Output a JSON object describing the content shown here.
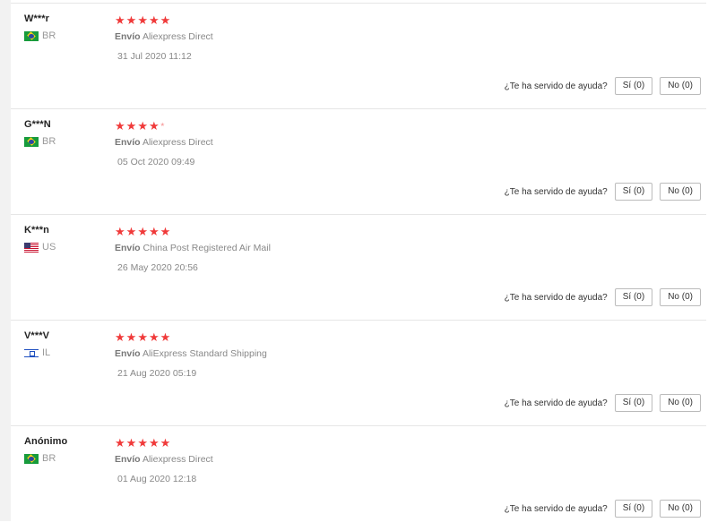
{
  "helpful_question": "¿Te ha servido de ayuda?",
  "shipping_label": "Envío",
  "star_color": "#f03a3a",
  "reviews": [
    {
      "user": "W***r",
      "country": "BR",
      "flag": "flag-br",
      "rating": 5,
      "shipping_method": "Aliexpress Direct",
      "date": "31 Jul 2020 11:12",
      "yes_label": "Sí (0)",
      "no_label": "No (0)"
    },
    {
      "user": "G***N",
      "country": "BR",
      "flag": "flag-br",
      "rating": 4,
      "shipping_method": "Aliexpress Direct",
      "date": "05 Oct 2020 09:49",
      "yes_label": "Sí (0)",
      "no_label": "No (0)"
    },
    {
      "user": "K***n",
      "country": "US",
      "flag": "flag-us",
      "rating": 5,
      "shipping_method": "China Post Registered Air Mail",
      "date": "26 May 2020 20:56",
      "yes_label": "Sí (0)",
      "no_label": "No (0)"
    },
    {
      "user": "V***V",
      "country": "IL",
      "flag": "flag-il",
      "rating": 5,
      "shipping_method": "AliExpress Standard Shipping",
      "date": "21 Aug 2020 05:19",
      "yes_label": "Sí (0)",
      "no_label": "No (0)"
    },
    {
      "user": "Anónimo",
      "country": "BR",
      "flag": "flag-br",
      "rating": 5,
      "shipping_method": "Aliexpress Direct",
      "date": "01 Aug 2020 12:18",
      "yes_label": "Sí (0)",
      "no_label": "No (0)"
    }
  ]
}
